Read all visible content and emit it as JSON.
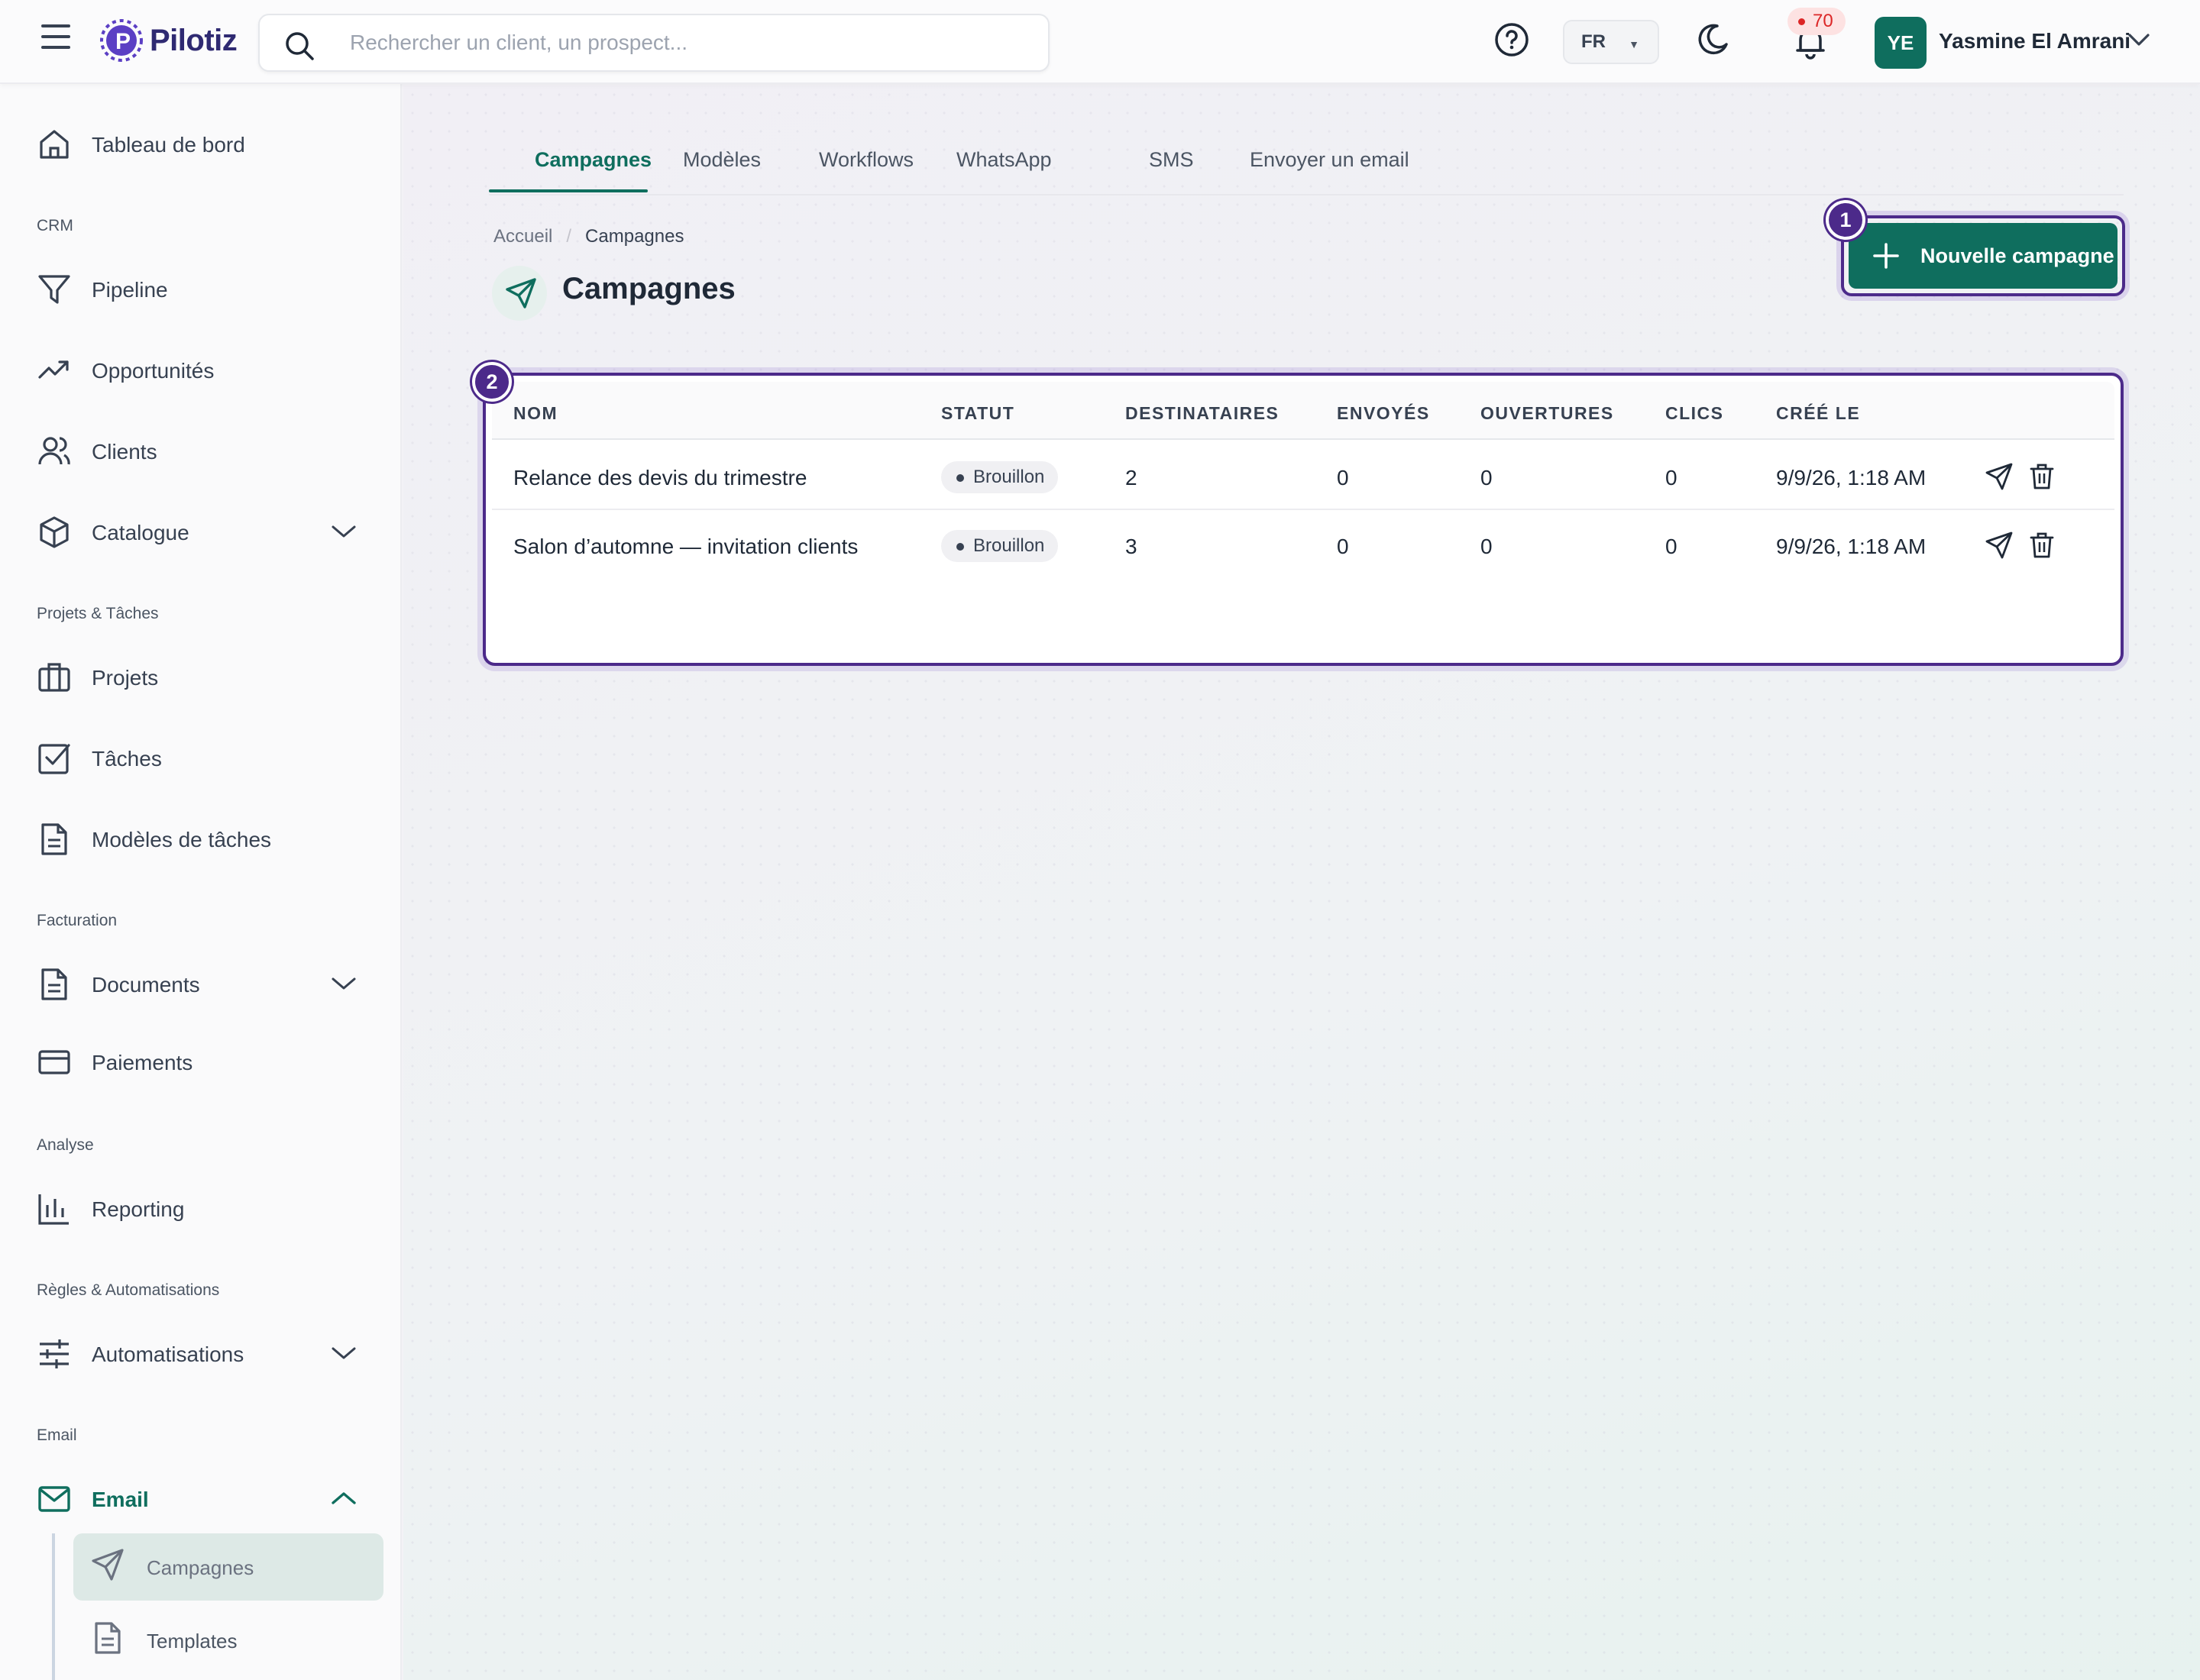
{
  "app": {
    "name": "Pilotiz"
  },
  "search": {
    "placeholder": "Rechercher un client, un prospect..."
  },
  "header": {
    "language": "FR",
    "notifications_count": "70",
    "user_initials": "YE",
    "user_name": "Yasmine El Amrani"
  },
  "sidebar": {
    "items": [
      {
        "label": "Tableau de bord",
        "icon": "home-icon"
      },
      {
        "section": "CRM"
      },
      {
        "label": "Pipeline",
        "icon": "funnel-icon"
      },
      {
        "label": "Opportunités",
        "icon": "trending-up-icon"
      },
      {
        "label": "Clients",
        "icon": "users-icon"
      },
      {
        "label": "Catalogue",
        "icon": "box-icon"
      },
      {
        "section": "Projets & Tâches"
      },
      {
        "label": "Projets",
        "icon": "briefcase-icon"
      },
      {
        "label": "Tâches",
        "icon": "checkbox-icon"
      },
      {
        "label": "Modèles de tâches",
        "icon": "document-icon"
      },
      {
        "section": "Facturation"
      },
      {
        "label": "Documents",
        "icon": "document-icon"
      },
      {
        "label": "Paiements",
        "icon": "credit-card-icon"
      },
      {
        "section": "Analyse"
      },
      {
        "label": "Reporting",
        "icon": "bar-chart-icon"
      },
      {
        "section": "Règles & Automatisations"
      },
      {
        "label": "Automatisations",
        "icon": "sliders-icon"
      },
      {
        "section": "Email"
      },
      {
        "label": "Email",
        "icon": "mail-icon"
      }
    ],
    "sections": {
      "crm": "CRM",
      "projects": "Projets & Tâches",
      "billing": "Facturation",
      "analysis": "Analyse",
      "rules": "Règles & Automatisations",
      "email": "Email"
    },
    "labels": {
      "dashboard": "Tableau de bord",
      "pipeline": "Pipeline",
      "opportunities": "Opportunités",
      "clients": "Clients",
      "catalogue": "Catalogue",
      "projects": "Projets",
      "tasks": "Tâches",
      "task_templates": "Modèles de tâches",
      "documents": "Documents",
      "payments": "Paiements",
      "reporting": "Reporting",
      "automations": "Automatisations",
      "email": "Email"
    },
    "email_sub": {
      "campaigns": "Campagnes",
      "templates": "Templates"
    }
  },
  "main": {
    "tabs": {
      "campaigns": "Campagnes",
      "models": "Modèles",
      "workflows": "Workflows",
      "whatsapp": "WhatsApp",
      "sms": "SMS",
      "send_email": "Envoyer un email"
    },
    "breadcrumb": {
      "home": "Accueil",
      "current": "Campagnes"
    },
    "title": "Campagnes",
    "new_button": "Nouvelle campagne",
    "markers": {
      "first": "1",
      "second": "2"
    },
    "table": {
      "headers": {
        "name": "NOM",
        "status": "STATUT",
        "recipients": "DESTINATAIRES",
        "sent": "ENVOYÉS",
        "opens": "OUVERTURES",
        "clicks": "CLICS",
        "created": "CRÉÉ LE"
      },
      "rows": [
        {
          "name": "Relance des devis du trimestre",
          "status": "Brouillon",
          "recipients": "2",
          "sent": "0",
          "opens": "0",
          "clicks": "0",
          "created": "9/9/26, 1:18 AM"
        },
        {
          "name": "Salon d’automne — invitation clients",
          "status": "Brouillon",
          "recipients": "3",
          "sent": "0",
          "opens": "0",
          "clicks": "0",
          "created": "9/9/26, 1:18 AM"
        }
      ]
    }
  },
  "colors": {
    "brand": "#0f6e5e",
    "highlight": "#4c2a8a",
    "badge_red": "#dc2626"
  }
}
